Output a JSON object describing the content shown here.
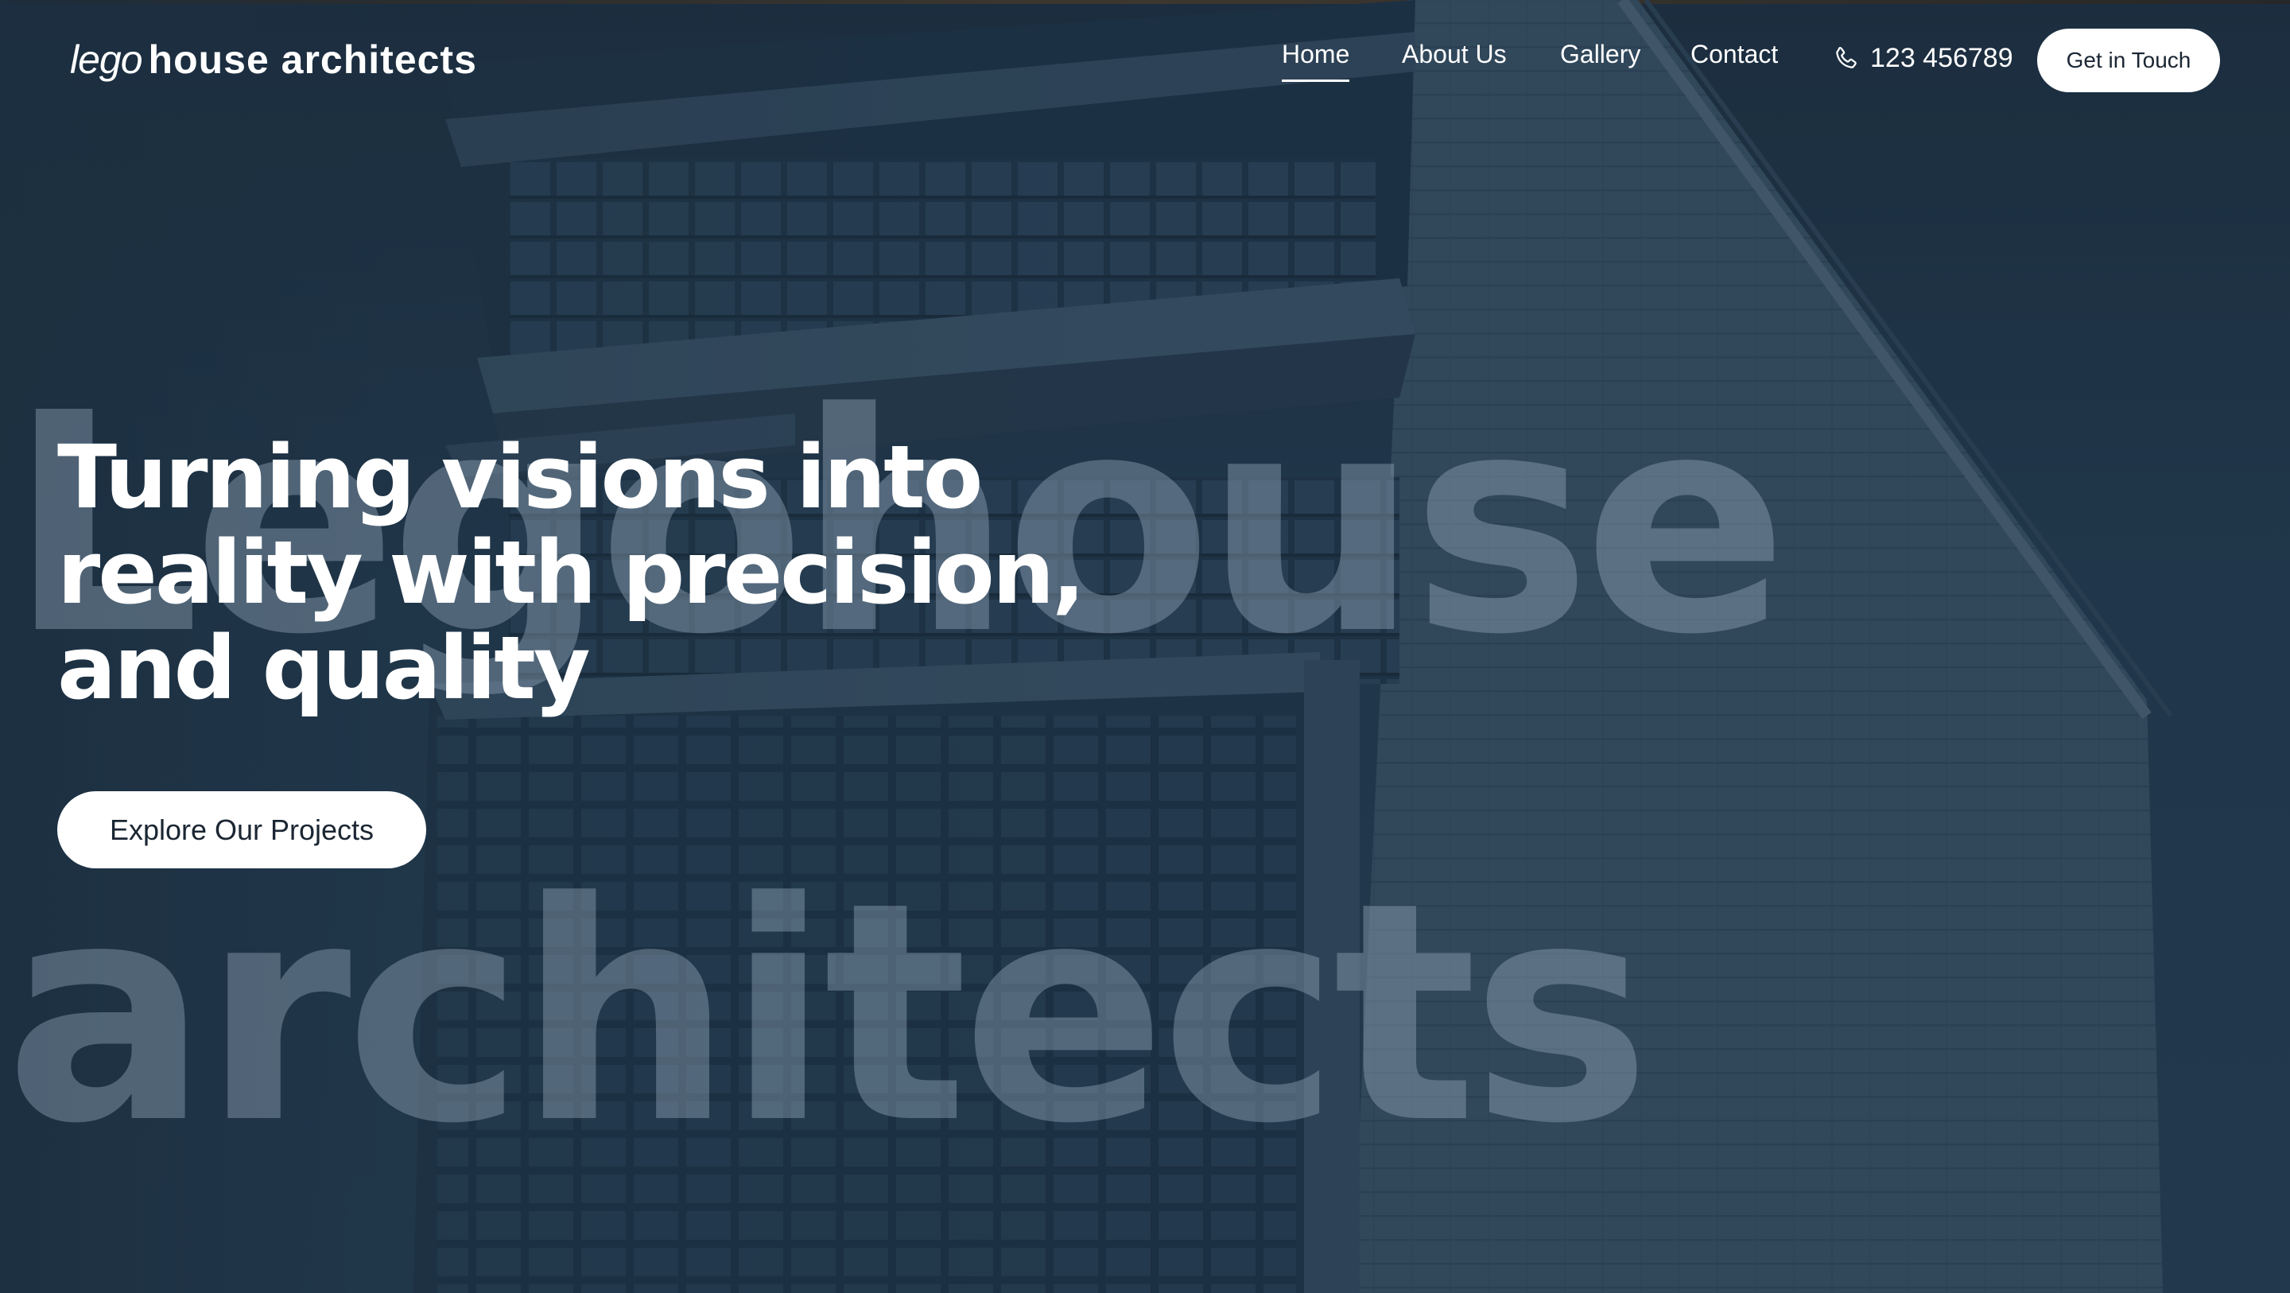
{
  "brand": {
    "logo_light": "lego",
    "logo_bold": "house architects"
  },
  "nav": {
    "items": [
      {
        "label": "Home",
        "active": true
      },
      {
        "label": "About Us",
        "active": false
      },
      {
        "label": "Gallery",
        "active": false
      },
      {
        "label": "Contact",
        "active": false
      }
    ],
    "phone": "123 456789",
    "phone_icon": "phone-icon",
    "cta_label": "Get in Touch"
  },
  "hero": {
    "title_lines": [
      "Turning visions into",
      "reality with precision,",
      "and quality"
    ],
    "button_label": "Explore Our Projects"
  },
  "watermark": {
    "line1": "Legohouse",
    "line2": "architects"
  },
  "colors": {
    "background": "#1c2f40",
    "text": "#ffffff",
    "button_bg": "#ffffff",
    "button_text": "#1b2633"
  }
}
